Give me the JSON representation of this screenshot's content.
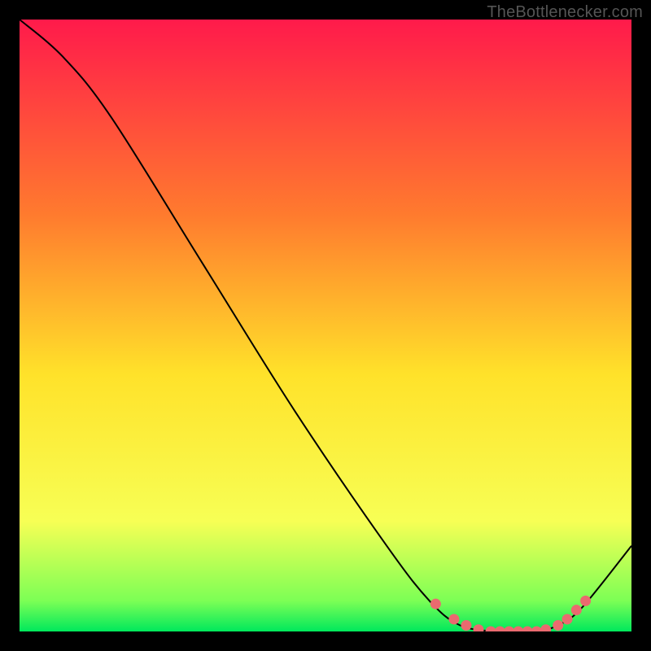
{
  "watermark": "TheBottlenecker.com",
  "chart_data": {
    "type": "line",
    "title": "",
    "xlabel": "",
    "ylabel": "",
    "xlim": [
      0,
      100
    ],
    "ylim": [
      0,
      100
    ],
    "grid": false,
    "legend": false,
    "background_gradient": [
      "#ff1a4b",
      "#ff7b2e",
      "#ffe22a",
      "#f7ff55",
      "#7cff55",
      "#00e85c"
    ],
    "curve": [
      {
        "x": 0,
        "y": 100
      },
      {
        "x": 7,
        "y": 94
      },
      {
        "x": 15,
        "y": 84
      },
      {
        "x": 30,
        "y": 60
      },
      {
        "x": 45,
        "y": 36
      },
      {
        "x": 60,
        "y": 14
      },
      {
        "x": 67,
        "y": 5
      },
      {
        "x": 72,
        "y": 1
      },
      {
        "x": 78,
        "y": 0
      },
      {
        "x": 84,
        "y": 0
      },
      {
        "x": 88,
        "y": 1
      },
      {
        "x": 92,
        "y": 4
      },
      {
        "x": 100,
        "y": 14
      }
    ],
    "markers": [
      {
        "x": 68,
        "y": 4.5
      },
      {
        "x": 71,
        "y": 2
      },
      {
        "x": 73,
        "y": 1
      },
      {
        "x": 75,
        "y": 0.3
      },
      {
        "x": 77,
        "y": 0
      },
      {
        "x": 78.5,
        "y": 0
      },
      {
        "x": 80,
        "y": 0
      },
      {
        "x": 81.5,
        "y": 0
      },
      {
        "x": 83,
        "y": 0
      },
      {
        "x": 84.5,
        "y": 0
      },
      {
        "x": 86,
        "y": 0.3
      },
      {
        "x": 88,
        "y": 1
      },
      {
        "x": 89.5,
        "y": 2
      },
      {
        "x": 91,
        "y": 3.5
      },
      {
        "x": 92.5,
        "y": 5
      }
    ],
    "marker_color": "#ea6a6f",
    "line_color": "#000000"
  }
}
